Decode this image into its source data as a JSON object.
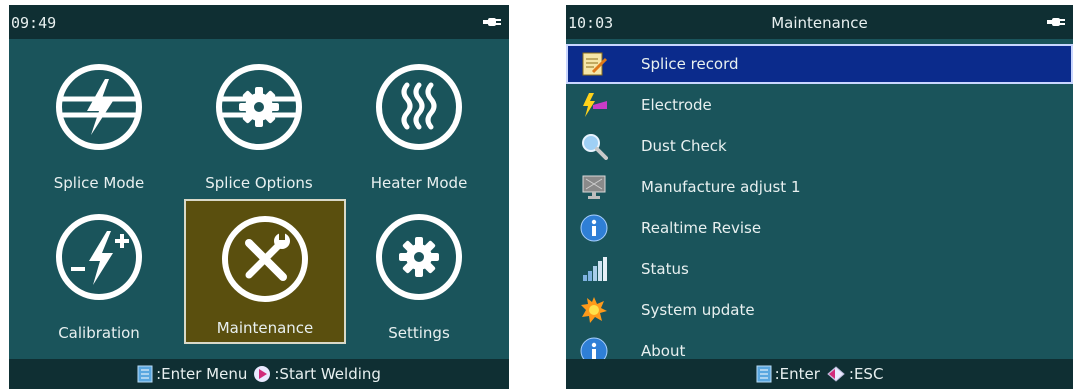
{
  "colors": {
    "screen_bg": "#1a545b",
    "bar_bg": "#0f2f33",
    "selected_tile": "#5a4f0e",
    "selected_row": "#0b2b8c"
  },
  "main_menu": {
    "time": "09:49",
    "power_icon": "plug-icon",
    "tiles": [
      {
        "label": "Splice Mode",
        "icon": "splice-mode-icon",
        "selected": false
      },
      {
        "label": "Splice Options",
        "icon": "splice-options-icon",
        "selected": false
      },
      {
        "label": "Heater Mode",
        "icon": "heater-icon",
        "selected": false
      },
      {
        "label": "Calibration",
        "icon": "calibration-icon",
        "selected": false
      },
      {
        "label": "Maintenance",
        "icon": "tools-icon",
        "selected": true
      },
      {
        "label": "Settings",
        "icon": "gear-icon",
        "selected": false
      }
    ],
    "footer": {
      "enter_label": ":Enter Menu",
      "start_label": ":Start Welding"
    }
  },
  "maintenance_menu": {
    "time": "10:03",
    "title": "Maintenance",
    "power_icon": "plug-icon",
    "items": [
      {
        "label": "Splice record",
        "icon": "notepad-icon",
        "selected": true
      },
      {
        "label": "Electrode",
        "icon": "electrode-icon",
        "selected": false
      },
      {
        "label": "Dust Check",
        "icon": "magnifier-icon",
        "selected": false
      },
      {
        "label": "Manufacture adjust 1",
        "icon": "monitor-icon",
        "selected": false
      },
      {
        "label": "Realtime Revise",
        "icon": "info-icon",
        "selected": false
      },
      {
        "label": "Status",
        "icon": "signal-bars-icon",
        "selected": false
      },
      {
        "label": "System update",
        "icon": "update-icon",
        "selected": false
      },
      {
        "label": "About",
        "icon": "info-icon",
        "selected": false
      }
    ],
    "footer": {
      "enter_label": ":Enter",
      "esc_label": ":ESC"
    }
  }
}
